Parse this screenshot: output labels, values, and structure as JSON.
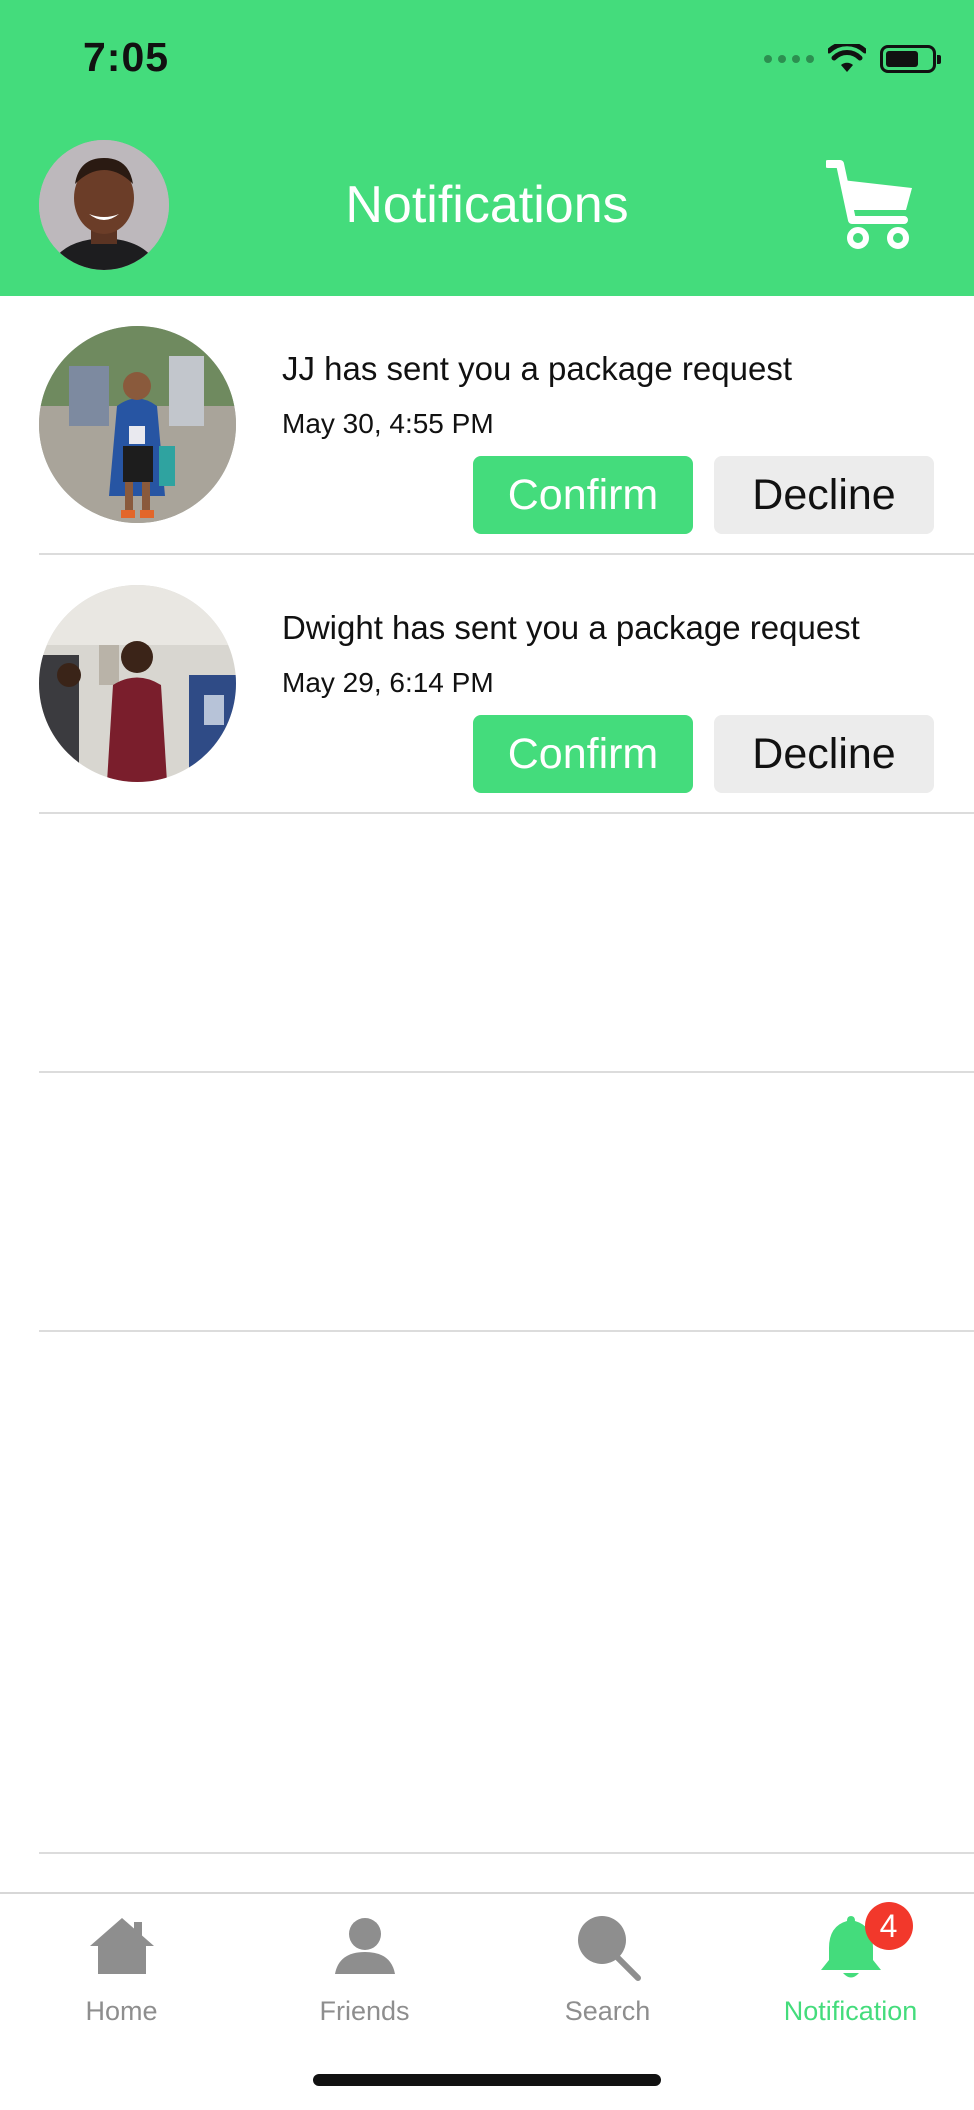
{
  "status_bar": {
    "time": "7:05"
  },
  "header": {
    "title": "Notifications",
    "avatar_icon": "profile-avatar",
    "cart_icon": "cart-icon"
  },
  "notifications": [
    {
      "message": "JJ has sent you a package request",
      "time": "May 30, 4:55 PM",
      "confirm_label": "Confirm",
      "decline_label": "Decline"
    },
    {
      "message": "Dwight has sent you a package request",
      "time": "May 29, 6:14 PM",
      "confirm_label": "Confirm",
      "decline_label": "Decline"
    }
  ],
  "tabbar": {
    "tabs": [
      {
        "label": "Home",
        "icon": "home-icon"
      },
      {
        "label": "Friends",
        "icon": "person-icon"
      },
      {
        "label": "Search",
        "icon": "search-icon"
      },
      {
        "label": "Notification",
        "icon": "bell-icon",
        "badge": "4",
        "active": true
      }
    ]
  },
  "colors": {
    "accent": "#44DC7C",
    "badge": "#F2382B",
    "decline_bg": "#ECECEC",
    "inactive_tab": "#8E8E8E"
  }
}
